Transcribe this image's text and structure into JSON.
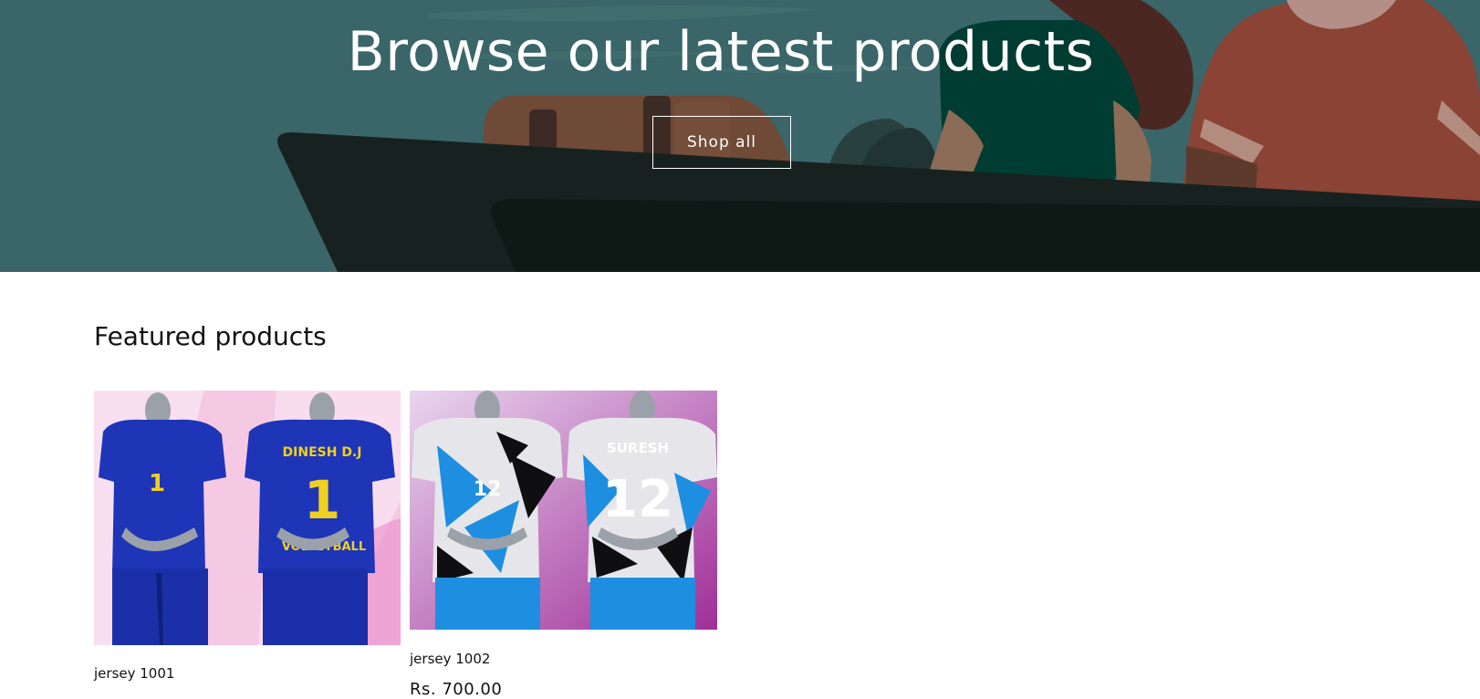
{
  "hero": {
    "title": "Browse our latest products",
    "button_label": "Shop all",
    "colors": {
      "background": "#3a6569",
      "boat": "#172220"
    }
  },
  "featured": {
    "heading": "Featured products",
    "products": [
      {
        "title": "jersey 1001",
        "price": "",
        "image": "blue-volleyball-jersey",
        "jersey_name": "DINESH D.J",
        "jersey_number": "1"
      },
      {
        "title": "jersey 1002",
        "price": "Rs. 700.00",
        "image": "blue-white-camo-jersey",
        "jersey_name": "SURESH",
        "jersey_number": "12"
      }
    ]
  }
}
